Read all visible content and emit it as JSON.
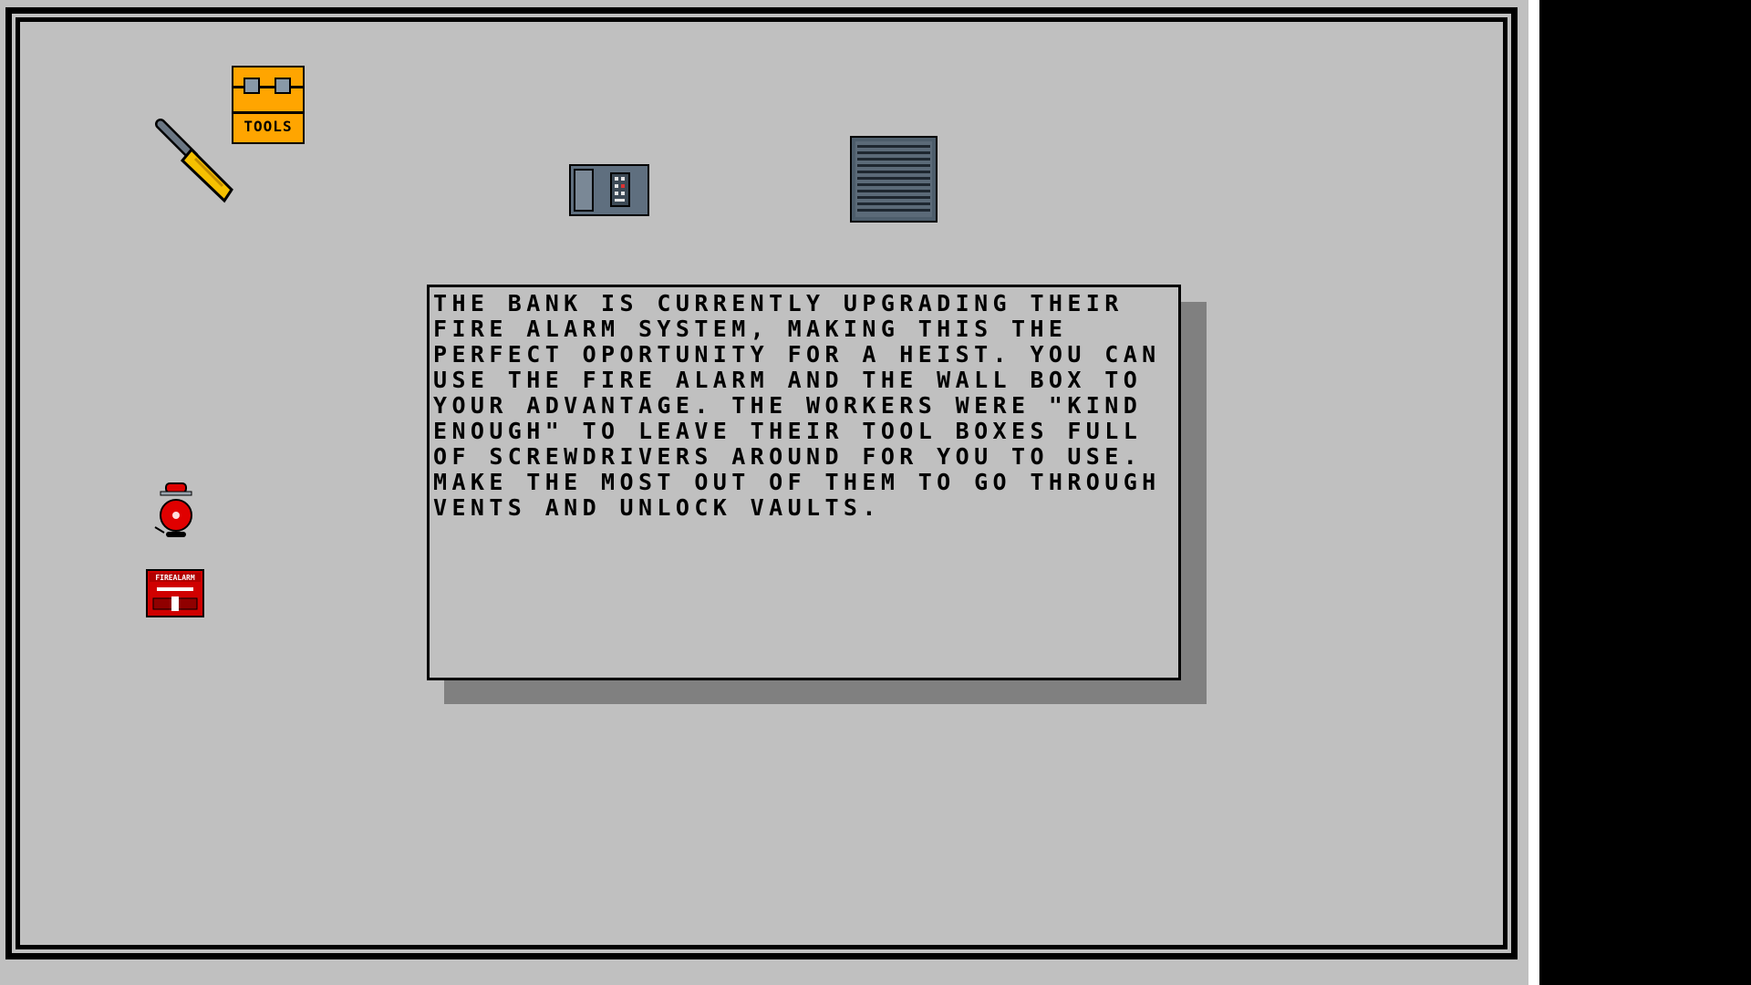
{
  "game": {
    "dialog": {
      "lines": [
        "THE BANK IS CURRENTLY UPGRADING THEIR",
        "FIRE ALARM SYSTEM, MAKING THIS THE",
        "PERFECT OPORTUNITY FOR A HEIST. YOU CAN",
        "USE THE FIRE ALARM AND THE WALL BOX TO",
        "YOUR ADVANTAGE. THE WORKERS WERE \"KIND",
        "ENOUGH\" TO LEAVE THEIR TOOL BOXES FULL",
        "OF SCREWDRIVERS AROUND FOR YOU TO USE.",
        "MAKE THE MOST OUT OF THEM TO GO THROUGH",
        "VENTS AND UNLOCK VAULTS."
      ]
    },
    "items": {
      "toolbox": {
        "icon": "toolbox-icon",
        "label": "TOOLS",
        "color": "#ffa500"
      },
      "screwdriver": {
        "icon": "screwdriver-icon",
        "color": "#f5c000"
      },
      "wall_box": {
        "icon": "wall-box-icon",
        "color": "#5f6f7f"
      },
      "vent": {
        "icon": "vent-icon",
        "color": "#4d5d6b"
      },
      "fire_alarm_bell": {
        "icon": "alarm-bell-icon",
        "color": "#e00000"
      },
      "fire_alarm_box": {
        "icon": "fire-alarm-box-icon",
        "label": "FIREALARM",
        "color": "#d00000"
      }
    },
    "colors": {
      "floor": "#c0c0c0",
      "border": "#000000",
      "dialog_shadow": "#808080"
    }
  }
}
